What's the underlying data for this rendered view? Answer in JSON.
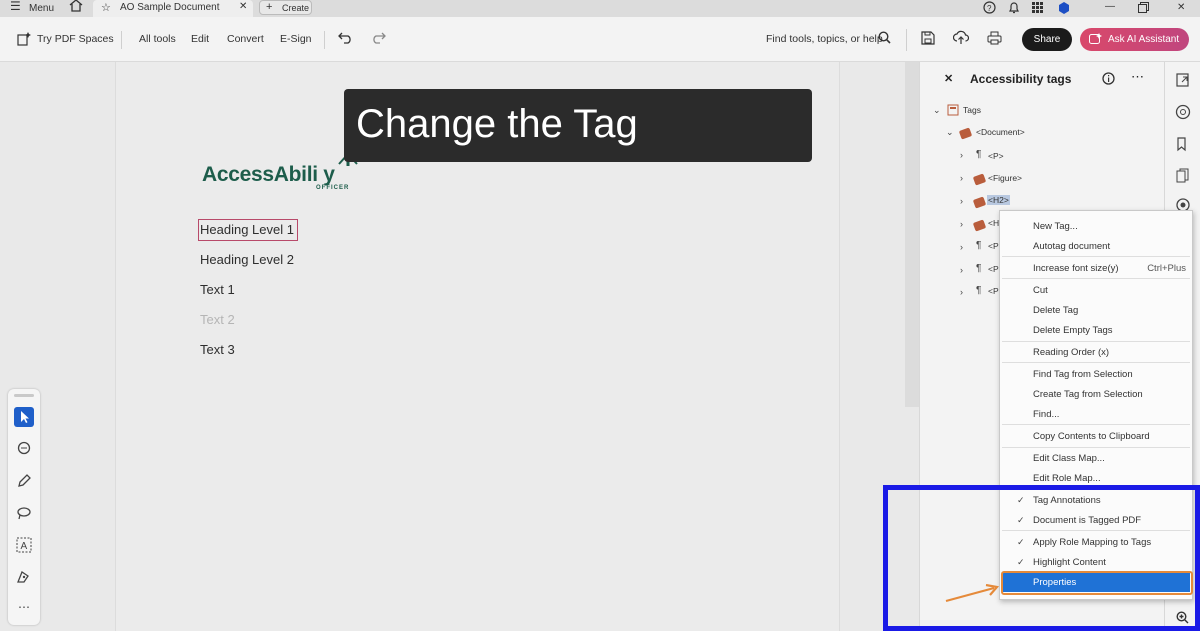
{
  "titlebar": {
    "menu_label": "Menu",
    "tab_title": "AO Sample Document",
    "create_label": "Create"
  },
  "toolbar": {
    "try_pdf_spaces": "Try PDF Spaces",
    "all_tools": "All tools",
    "edit": "Edit",
    "convert": "Convert",
    "esign": "E-Sign",
    "search_placeholder": "Find tools, topics, or help",
    "share": "Share",
    "ask_ai": "Ask AI Assistant"
  },
  "caption": "Change the Tag",
  "document": {
    "logo_text": "AccessAbili y",
    "logo_sub": "OFFICER",
    "lines": [
      "Heading Level 1",
      "Heading Level 2",
      "Text 1",
      "Text 2",
      "Text 3"
    ]
  },
  "panel": {
    "title": "Accessibility tags",
    "tree": [
      {
        "label": "Tags"
      },
      {
        "label": "<Document>"
      },
      {
        "label": "<P>"
      },
      {
        "label": "<Figure>"
      },
      {
        "label": "<H2>"
      },
      {
        "label": "<H"
      },
      {
        "label": "<P"
      },
      {
        "label": "<P"
      },
      {
        "label": "<P"
      }
    ]
  },
  "context_menu": {
    "items": [
      {
        "label": "New Tag...",
        "shortcut": ""
      },
      {
        "label": "Autotag document",
        "shortcut": ""
      },
      {
        "label": "Increase font size(y)",
        "shortcut": "Ctrl+Plus"
      },
      {
        "label": "Cut",
        "shortcut": ""
      },
      {
        "label": "Delete Tag",
        "shortcut": ""
      },
      {
        "label": "Delete Empty Tags",
        "shortcut": ""
      },
      {
        "label": "Reading Order (x)",
        "shortcut": ""
      },
      {
        "label": "Find Tag from Selection",
        "shortcut": ""
      },
      {
        "label": "Create Tag from Selection",
        "shortcut": ""
      },
      {
        "label": "Find...",
        "shortcut": ""
      },
      {
        "label": "Copy Contents to Clipboard",
        "shortcut": ""
      },
      {
        "label": "Edit Class Map...",
        "shortcut": ""
      },
      {
        "label": "Edit Role Map...",
        "shortcut": ""
      },
      {
        "label": "Tag Annotations",
        "shortcut": "",
        "checked": true
      },
      {
        "label": "Document is Tagged PDF",
        "shortcut": "",
        "checked": true
      },
      {
        "label": "Apply Role Mapping to Tags",
        "shortcut": "",
        "checked": true
      },
      {
        "label": "Highlight Content",
        "shortcut": "",
        "checked": true
      },
      {
        "label": "Properties",
        "shortcut": "",
        "selected": true
      }
    ]
  },
  "colors": {
    "highlight_box": "#1a1ae6",
    "callout": "#e58a3a",
    "menu_selection": "#1f72d6"
  }
}
